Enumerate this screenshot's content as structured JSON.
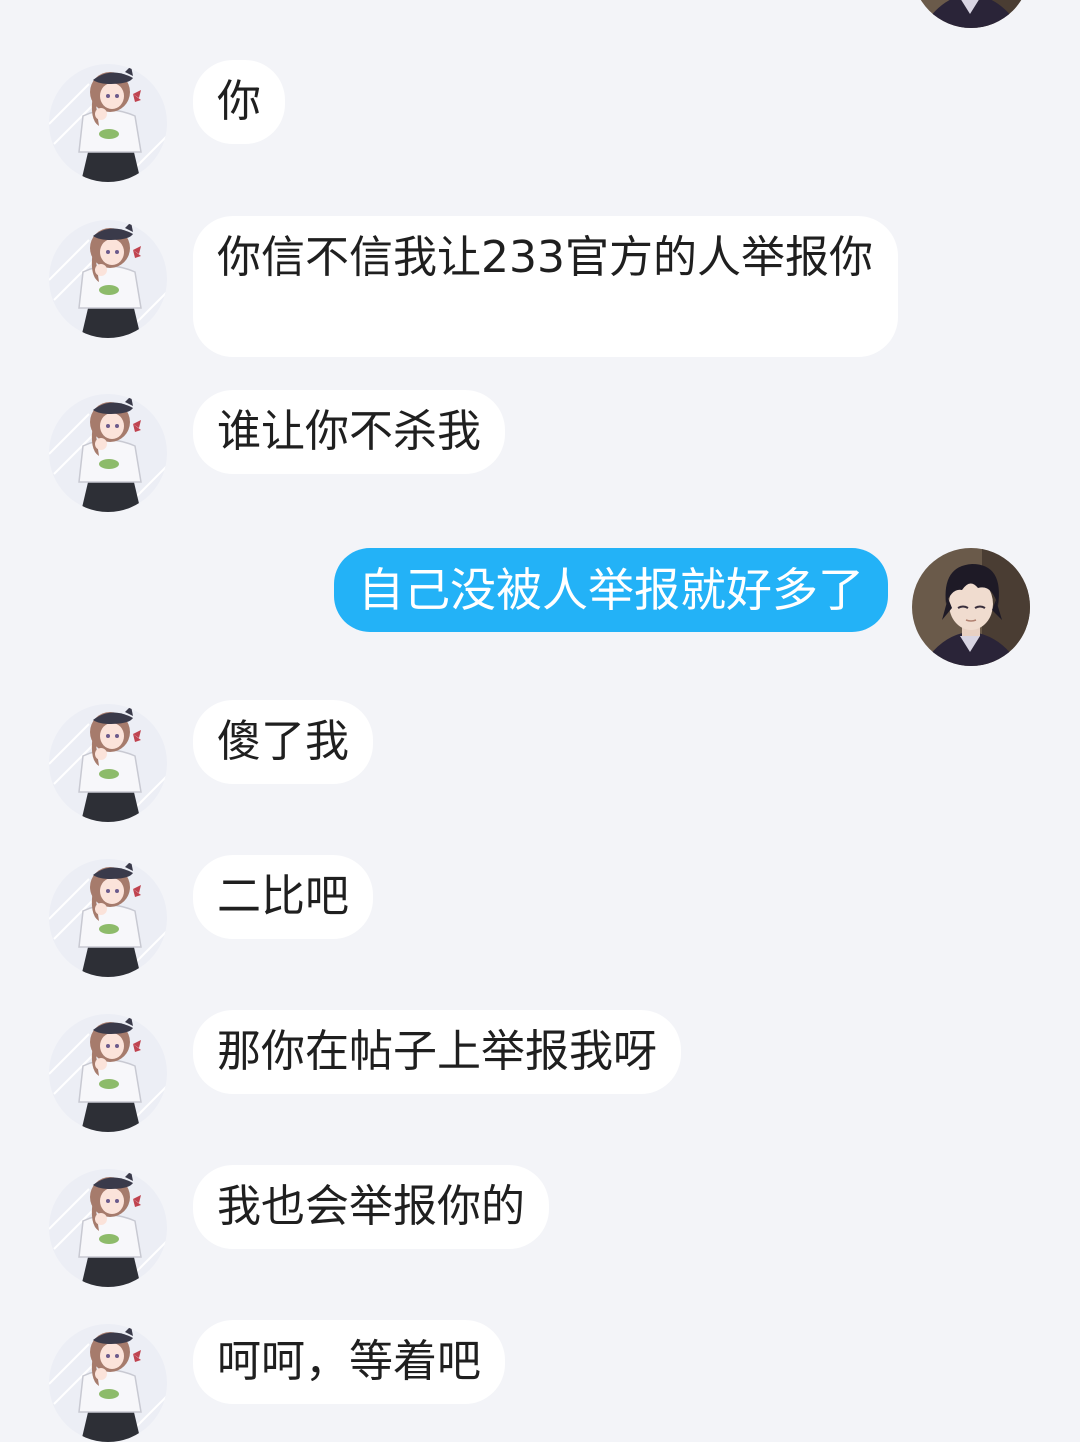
{
  "chat": {
    "contact_avatar": "girl-avatar",
    "self_avatar": "boy-avatar",
    "colors": {
      "background": "#f3f4f8",
      "incoming_bubble": "#ffffff",
      "outgoing_bubble": "#23b2f7",
      "incoming_text": "#1f1f1f",
      "outgoing_text": "#ffffff"
    },
    "messages": [
      {
        "side": "in",
        "text": "你"
      },
      {
        "side": "in",
        "text": "你信不信我让233官方的人举报你"
      },
      {
        "side": "in",
        "text": "谁让你不杀我"
      },
      {
        "side": "out",
        "text": "自己没被人举报就好多了"
      },
      {
        "side": "in",
        "text": "傻了我"
      },
      {
        "side": "in",
        "text": "二比吧"
      },
      {
        "side": "in",
        "text": "那你在帖子上举报我呀"
      },
      {
        "side": "in",
        "text": "我也会举报你的"
      },
      {
        "side": "in",
        "text": "呵呵，等着吧"
      }
    ]
  }
}
